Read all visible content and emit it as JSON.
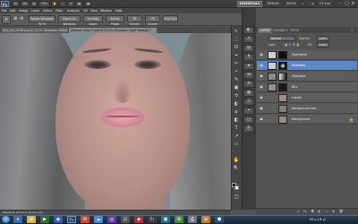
{
  "app": {
    "logo": "Ps",
    "zoom": "33%",
    "workspaces": [
      "ESSENTIALS",
      "DESIGN",
      "ZIPLIN",
      "»"
    ],
    "cs_live": "CS Live"
  },
  "menu": [
    "File",
    "Edit",
    "Image",
    "Layer",
    "Select",
    "Filter",
    "Analysis",
    "3D",
    "View",
    "Window",
    "Help"
  ],
  "options_bar": {
    "buttons": [
      "Resize Windows To Fit",
      "Zoom All Windows",
      "Scrubby Zoom",
      "Actual Pixels",
      "Fit Screen",
      "Fill Screen",
      "Print Size"
    ]
  },
  "document_tabs": [
    {
      "label": "Bild_DSC_0039.psd @ 33.3% (Shadows, RGB/8) *",
      "active": false
    },
    {
      "label": "glamour retouch.psd @ 33.3% (Shadows, Layer Mask/8) *",
      "active": true
    }
  ],
  "status": {
    "text": "Exposure works in 32-bit only"
  },
  "tools": [
    "↖",
    "⬚",
    "ʘ",
    "⌖",
    "✂",
    "⌁",
    "✎",
    "▣",
    "⟲",
    "◐",
    "⌀",
    "◧",
    "T",
    "↗",
    "▭",
    "✋",
    "🔍"
  ],
  "dock_icons": [
    "◧",
    "A",
    "▤",
    "¶",
    "◈",
    "⊞",
    "⚙",
    "▦",
    "☰",
    "✦",
    "◳",
    "⎘"
  ],
  "layers_panel": {
    "tabs": [
      "LAYERS",
      "CHANNELS",
      "PATHS"
    ],
    "blend_mode": "Normal",
    "opacity_label": "Opacity:",
    "opacity_value": "100%",
    "lock_label": "Lock:",
    "lock_icons": "▦ ✎ ✥ 🔒",
    "fill_label": "Fill:",
    "fill_value": "100%",
    "layers": [
      {
        "name": "Highlights",
        "selected": false
      },
      {
        "name": "Shadows",
        "selected": true
      },
      {
        "name": "Highpass",
        "selected": false
      },
      {
        "name": "Blur",
        "selected": false
      },
      {
        "name": "Liquify",
        "selected": false
      },
      {
        "name": "background hair",
        "selected": false
      },
      {
        "name": "Background",
        "selected": false
      }
    ],
    "footer_icons": [
      "∞",
      "fx",
      "◘",
      "◐",
      "▭",
      "⊞",
      "🗑"
    ]
  },
  "taskbar": {
    "apps": [
      "e",
      "📁",
      "▶",
      "◉",
      "Ps",
      "✉",
      "☁",
      "◎",
      "☷",
      "◆",
      "Br",
      "▣",
      "✿",
      "⎙",
      "◍",
      "⬢"
    ],
    "tray_text": "DE ▴ ◂ ⚑ 🔊"
  },
  "colors": {
    "selection_blue": "#5b86c7",
    "panel_grey": "#535353",
    "canvas_backdrop": "#7e8e95"
  }
}
